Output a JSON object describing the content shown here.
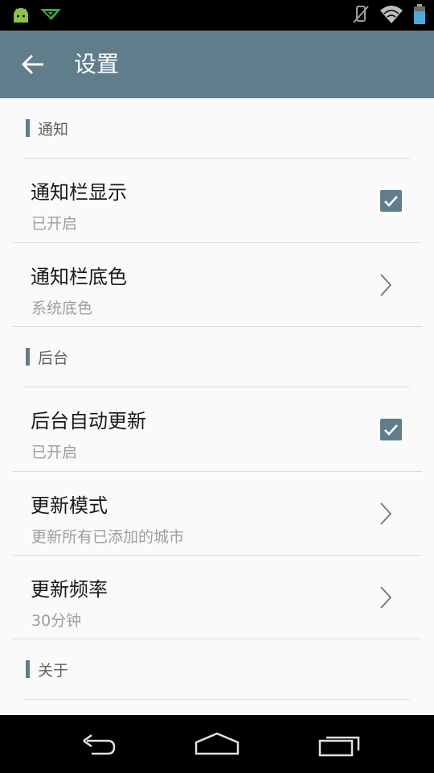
{
  "toolbar": {
    "title": "设置",
    "back_icon": "arrow-back-icon"
  },
  "status_bar": {
    "left_icons": [
      "android-icon",
      "app-notification-icon"
    ],
    "right_icons": [
      "vibrate-off-icon",
      "wifi-icon",
      "battery-icon"
    ]
  },
  "colors": {
    "accent": "#607d8b",
    "status_bar": "#000000",
    "background": "#fafafa"
  },
  "sections": [
    {
      "header": "通知",
      "items": [
        {
          "title": "通知栏显示",
          "summary": "已开启",
          "widget": "checkbox",
          "checked": true
        },
        {
          "title": "通知栏底色",
          "summary": "系统底色",
          "widget": "chevron"
        }
      ]
    },
    {
      "header": "后台",
      "items": [
        {
          "title": "后台自动更新",
          "summary": "已开启",
          "widget": "checkbox",
          "checked": true
        },
        {
          "title": "更新模式",
          "summary": "更新所有已添加的城市",
          "widget": "chevron"
        },
        {
          "title": "更新频率",
          "summary": "30分钟",
          "widget": "chevron"
        }
      ]
    },
    {
      "header": "关于",
      "items": []
    }
  ],
  "nav_bar": {
    "buttons": [
      "back-nav-icon",
      "home-nav-icon",
      "recents-nav-icon"
    ]
  }
}
